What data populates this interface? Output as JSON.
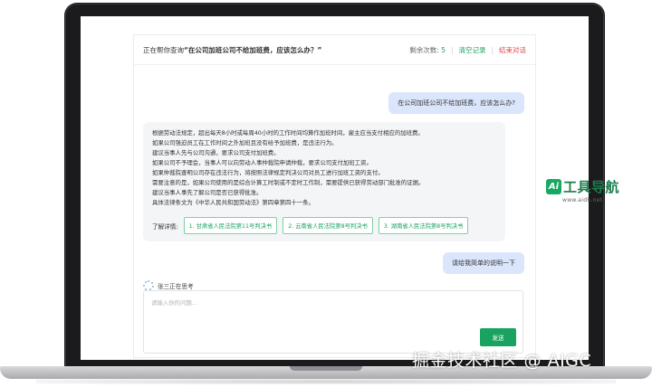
{
  "header": {
    "title_prefix": "正在帮你查询",
    "title_query": "“在公司加班公司不给加班费，应该怎么办？”",
    "remaining_label": "剩余次数:",
    "remaining_count": "5",
    "separator": "|",
    "clear_label": "清空记录",
    "end_label": "结束对话"
  },
  "conversation": {
    "user_question_1": "在公司加班公司不给加班费，应该怎么办?",
    "answer_lines": [
      "根据劳动法规定，超出每天8小时或每周40小时的工作时间均算作加班时间，雇主应当支付相应的加班费。",
      "如果公司强迫员工在工作时间之外加班且没有给予加班费，是违法行为。",
      "建议当事人先与公司沟通，要求公司支付加班费。",
      "如果公司不予理会，当事人可以向劳动人事仲裁院申请仲裁，要求公司支付加班工资。",
      "如果仲裁院查明公司存在违法行为，将按照法律规定判决公司对员工进行加班工资的支付。",
      "需要注意的是，如果公司使用的是综合计算工时制或不定时工作制，需要提供已获得劳动部门批准的证据。",
      "建议当事人事先了解公司是否已获得批准。",
      "具体法律条文为《中华人民共和国劳动法》第四章第四十一条。"
    ],
    "details_label": "了解详情:",
    "references": [
      "1. 甘肃省人民法院第11号判决书",
      "2. 云南省人民法院第8号判决书",
      "3. 湖南省人民法院第8号判决书"
    ],
    "user_question_2": "请给我简单的说明一下",
    "thinking_text": "张三正在思考"
  },
  "composer": {
    "placeholder": "请输入你的问题...",
    "send_label": "发送"
  },
  "overlay": {
    "logo_mark": "Ai",
    "logo_text": "工具导航",
    "logo_url": "www.aidh.net",
    "watermark": "掘金技术社区 @ AIGC"
  },
  "colors": {
    "accent_green": "#1aa260",
    "danger_red": "#e0454b",
    "user_bubble": "#dbe5fb",
    "answer_bubble": "#f4f5f7"
  },
  "icons": [
    "thinking-sparkle-icon"
  ]
}
